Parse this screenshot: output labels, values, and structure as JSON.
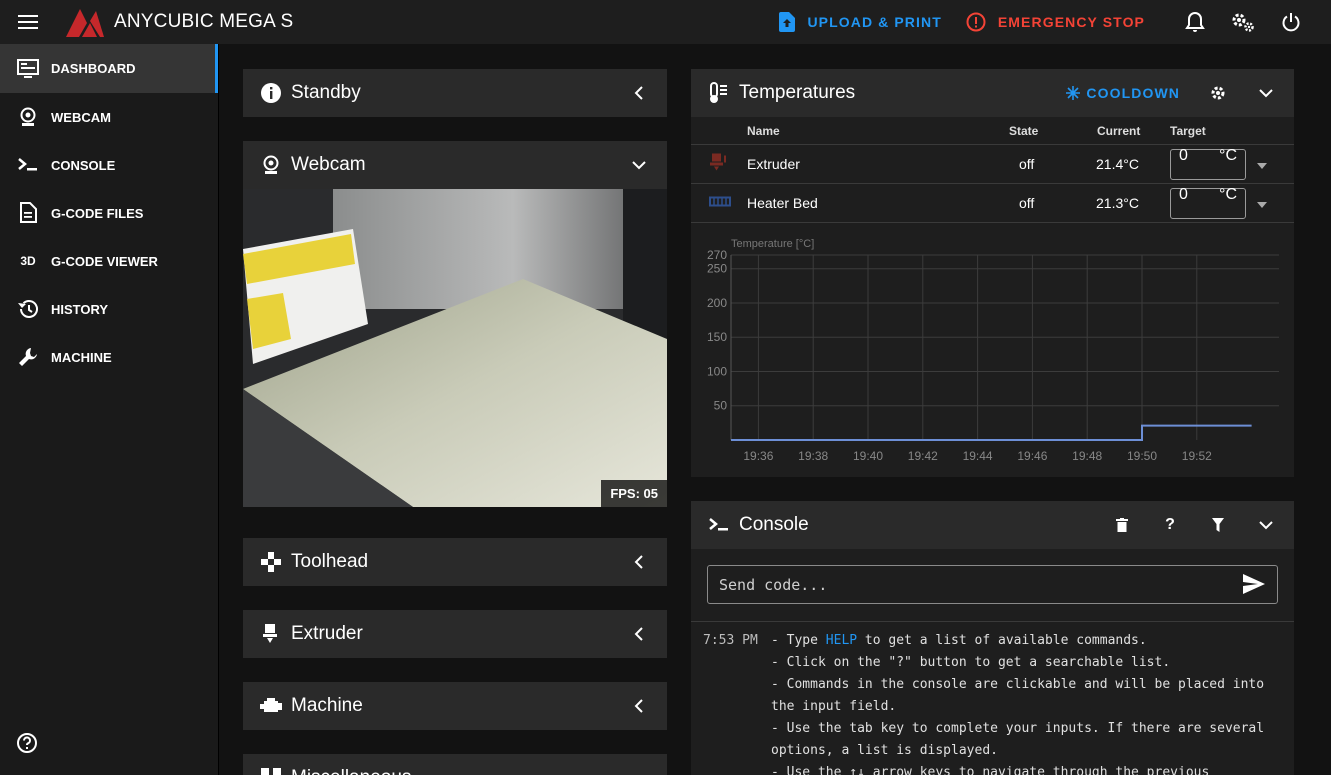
{
  "app": {
    "title": "ANYCUBIC MEGA S"
  },
  "topbar": {
    "upload_label": "UPLOAD & PRINT",
    "estop_label": "EMERGENCY STOP"
  },
  "sidebar": {
    "items": [
      {
        "label": "DASHBOARD",
        "icon": "monitor-icon",
        "active": true
      },
      {
        "label": "WEBCAM",
        "icon": "webcam-icon"
      },
      {
        "label": "CONSOLE",
        "icon": "console-icon"
      },
      {
        "label": "G-CODE FILES",
        "icon": "file-icon"
      },
      {
        "label": "G-CODE VIEWER",
        "icon": "3d-icon"
      },
      {
        "label": "HISTORY",
        "icon": "history-icon"
      },
      {
        "label": "MACHINE",
        "icon": "wrench-icon"
      }
    ]
  },
  "panels": {
    "standby": "Standby",
    "webcam": "Webcam",
    "fps": "FPS: 05",
    "toolhead": "Toolhead",
    "extruder": "Extruder",
    "machine": "Machine",
    "misc": "Miscellaneous"
  },
  "temperatures": {
    "title": "Temperatures",
    "cooldown_label": "COOLDOWN",
    "columns": {
      "name": "Name",
      "state": "State",
      "current": "Current",
      "target": "Target"
    },
    "rows": [
      {
        "name": "Extruder",
        "state": "off",
        "current": "21.4°C",
        "target": "0",
        "unit": "°C"
      },
      {
        "name": "Heater Bed",
        "state": "off",
        "current": "21.3°C",
        "target": "0",
        "unit": "°C"
      }
    ]
  },
  "chart_data": {
    "type": "line",
    "ylabel": "Temperature [°C]",
    "ylim": [
      0,
      270
    ],
    "yticks": [
      50,
      100,
      150,
      200,
      250,
      270
    ],
    "xticks": [
      "19:36",
      "19:38",
      "19:40",
      "19:42",
      "19:44",
      "19:46",
      "19:48",
      "19:50",
      "19:52"
    ],
    "x_minutes": [
      35,
      55
    ],
    "series": [
      {
        "values_time": [
          "19:35",
          "19:50",
          "19:50",
          "19:54"
        ],
        "values": [
          0,
          0,
          21,
          21
        ],
        "color": "#6d8fd6"
      }
    ],
    "grid": true
  },
  "console": {
    "title": "Console",
    "placeholder": "Send code...",
    "log_time": "7:53 PM",
    "line1_pre": "- Type ",
    "line1_link": "HELP",
    "line1_post": " to get a list of available commands.",
    "line2": "- Click on the \"?\" button to get a searchable list.",
    "line3": "- Commands in the console are clickable and will be placed into the input field.",
    "line4": "- Use the tab key to complete your inputs. If there are several options, a list is displayed.",
    "line5": "- Use the ↑↓ arrow keys to navigate through the previous"
  }
}
